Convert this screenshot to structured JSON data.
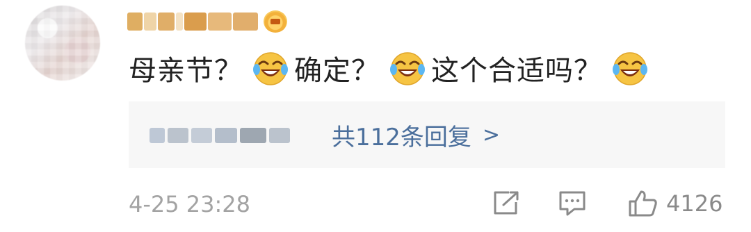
{
  "comment": {
    "body_part1": "母亲节？",
    "body_part2": "确定？",
    "body_part3": "这个合适吗？",
    "emoji": "laugh-cry-emoji"
  },
  "replies": {
    "summary": "共112条回复",
    "chevron": ">"
  },
  "meta": {
    "timestamp": "4-25 23:28",
    "like_count": "4126"
  },
  "icons": {
    "share": "share-icon",
    "comment": "comment-icon",
    "like": "thumbs-up-icon"
  },
  "colors": {
    "link": "#4b6f9c",
    "text": "#222222",
    "muted": "#a3a3a3",
    "reply_bg": "#f7f7f7",
    "emoji_yellow": "#f6c443"
  }
}
